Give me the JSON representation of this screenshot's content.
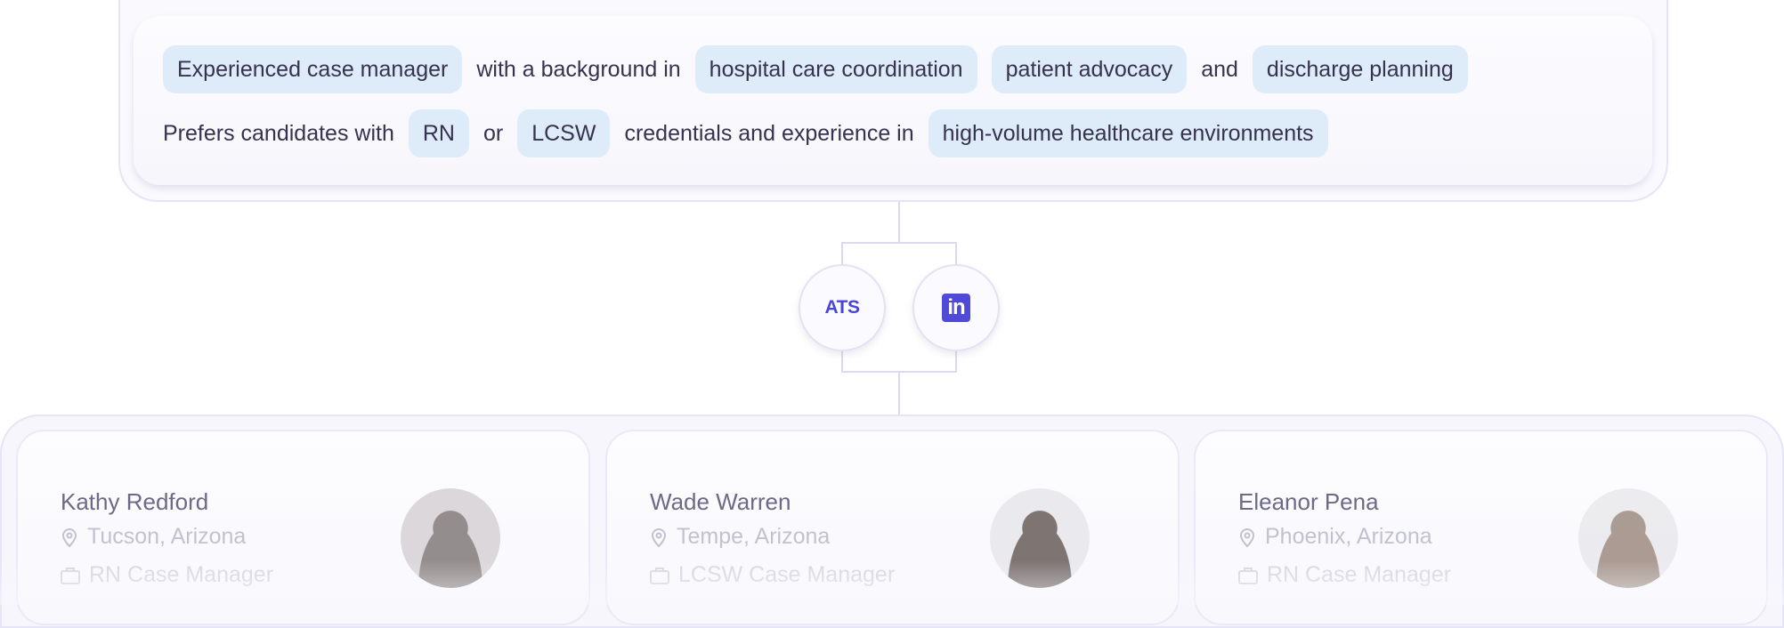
{
  "query": {
    "row1": [
      {
        "text": "Experienced case manager",
        "chip": true
      },
      {
        "text": "with a background in",
        "chip": false
      },
      {
        "text": "hospital care coordination",
        "chip": true
      },
      {
        "text": "patient advocacy",
        "chip": true
      },
      {
        "text": "and",
        "chip": false
      },
      {
        "text": "discharge planning",
        "chip": true
      }
    ],
    "row2": [
      {
        "text": "Prefers candidates with",
        "chip": false
      },
      {
        "text": "RN",
        "chip": true
      },
      {
        "text": "or",
        "chip": false
      },
      {
        "text": "LCSW",
        "chip": true
      },
      {
        "text": "credentials and experience in",
        "chip": false
      },
      {
        "text": "high-volume healthcare environments",
        "chip": true
      }
    ]
  },
  "sources": [
    {
      "label": "ATS",
      "icon": "ats-icon"
    },
    {
      "label": "in",
      "icon": "linkedin-icon"
    }
  ],
  "candidates": [
    {
      "name": "Kathy Redford",
      "location": "Tucson, Arizona",
      "role": "RN Case Manager"
    },
    {
      "name": "Wade Warren",
      "location": "Tempe, Arizona",
      "role": "LCSW Case Manager"
    },
    {
      "name": "Eleanor Pena",
      "location": "Phoenix, Arizona",
      "role": "RN Case Manager"
    }
  ],
  "colors": {
    "chip": "#deecfa",
    "accent": "#4f4ad8",
    "text": "#36324f"
  }
}
